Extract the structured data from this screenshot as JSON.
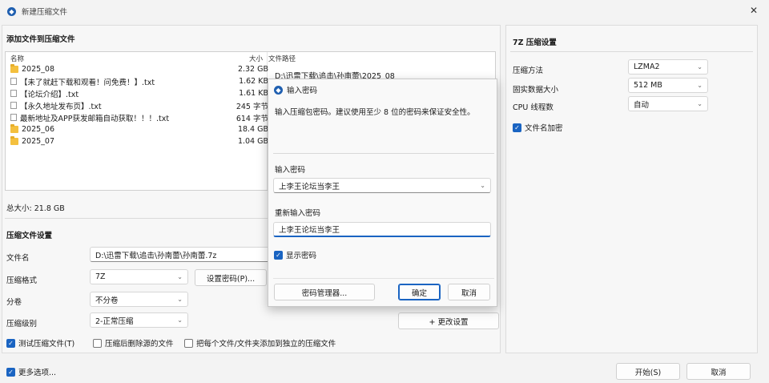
{
  "window": {
    "title": "新建压缩文件",
    "close_glyph": "✕",
    "app_icon": "7z-app-icon"
  },
  "files_section": {
    "title": "添加文件到压缩文件",
    "columns": {
      "name": "名称",
      "size": "大小",
      "path": "文件路径"
    },
    "path_value": "D:\\迅雷下载\\追击\\孙南蕾\\2025_08",
    "rows": [
      {
        "name": "2025_08",
        "size": "2.32 GB",
        "type": "folder"
      },
      {
        "name": "【未了就赶下载和观看！问免费！】.txt",
        "size": "1.62 KB",
        "type": "txt"
      },
      {
        "name": "【论坛介绍】.txt",
        "size": "1.61 KB",
        "type": "txt"
      },
      {
        "name": "【永久地址发布页】.txt",
        "size": "245 字节",
        "type": "txt"
      },
      {
        "name": "最新地址及APP获发邮箱自动获取！！！.txt",
        "size": "614 字节",
        "type": "txt"
      },
      {
        "name": "2025_06",
        "size": "18.4 GB",
        "type": "folder"
      },
      {
        "name": "2025_07",
        "size": "1.04 GB",
        "type": "folder"
      }
    ],
    "total": "总大小: 21.8 GB"
  },
  "compress_settings": {
    "title": "压缩文件设置",
    "filename_label": "文件名",
    "filename_value": "D:\\迅雷下载\\追击\\孙南蕾\\孙南蕾.7z",
    "format_label": "压缩格式",
    "format_value": "7Z",
    "set_password_label": "设置密码(P)...",
    "split_label": "分卷",
    "split_value": "不分卷",
    "level_label": "压缩级别",
    "level_value": "2-正常压缩",
    "advanced_label": "+ 更改设置",
    "test_label": "测试压缩文件(T)",
    "delete_label": "压缩后删除源的文件",
    "separate_label": "把每个文件/文件夹添加到独立的压缩文件"
  },
  "footer": {
    "more_options": "更多选项...",
    "start": "开始(S)",
    "cancel": "取消"
  },
  "right_panel": {
    "title": "7Z 压缩设置",
    "method_label": "压缩方法",
    "method_value": "LZMA2",
    "dict_label": "固实数据大小",
    "dict_value": "512 MB",
    "cpu_label": "CPU 线程数",
    "cpu_value": "自动",
    "encrypt_names_label": "文件名加密"
  },
  "password_dialog": {
    "title": "输入密码",
    "hint": "输入压缩包密码。建议使用至少 8 位的密码来保证安全性。",
    "enter_label": "输入密码",
    "enter_value": "上李王论坛当李王",
    "reenter_label": "重新输入密码",
    "reenter_value": "上李王论坛当李王",
    "show_label": "显示密码",
    "manager_label": "密码管理器...",
    "ok_label": "确定",
    "cancel_label": "取消"
  },
  "colors": {
    "accent": "#1a64c2",
    "folder": "#f4c03e"
  }
}
